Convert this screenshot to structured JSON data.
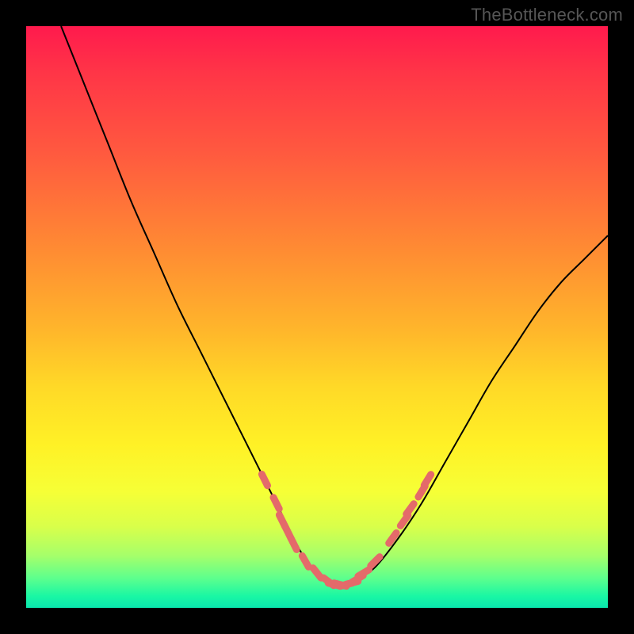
{
  "watermark": "TheBottleneck.com",
  "chart_data": {
    "type": "line",
    "title": "",
    "xlabel": "",
    "ylabel": "",
    "xlim": [
      0,
      100
    ],
    "ylim": [
      0,
      100
    ],
    "grid": false,
    "series": [
      {
        "name": "bottleneck-curve",
        "color": "#000000",
        "x": [
          6,
          10,
          14,
          18,
          22,
          26,
          30,
          34,
          38,
          41,
          43,
          45,
          47,
          49,
          51,
          53,
          55,
          57,
          60,
          64,
          68,
          72,
          76,
          80,
          84,
          88,
          92,
          96,
          100
        ],
        "y": [
          100,
          90,
          80,
          70,
          61,
          52,
          44,
          36,
          28,
          22,
          18,
          14,
          10,
          7,
          5,
          4,
          4,
          5,
          7,
          12,
          18,
          25,
          32,
          39,
          45,
          51,
          56,
          60,
          64
        ]
      }
    ],
    "markers": {
      "name": "highlight-dots",
      "color": "#e46a6a",
      "points": [
        {
          "x": 41,
          "y": 22
        },
        {
          "x": 43,
          "y": 18
        },
        {
          "x": 44,
          "y": 15
        },
        {
          "x": 45,
          "y": 13
        },
        {
          "x": 46,
          "y": 11
        },
        {
          "x": 48,
          "y": 8
        },
        {
          "x": 50,
          "y": 6
        },
        {
          "x": 52,
          "y": 4.5
        },
        {
          "x": 53,
          "y": 4
        },
        {
          "x": 54,
          "y": 4
        },
        {
          "x": 55,
          "y": 4
        },
        {
          "x": 56,
          "y": 4.3
        },
        {
          "x": 57,
          "y": 5
        },
        {
          "x": 58,
          "y": 6
        },
        {
          "x": 60,
          "y": 8
        },
        {
          "x": 63,
          "y": 12
        },
        {
          "x": 65,
          "y": 15
        },
        {
          "x": 66,
          "y": 17
        },
        {
          "x": 68,
          "y": 20
        },
        {
          "x": 69,
          "y": 22
        }
      ]
    }
  }
}
